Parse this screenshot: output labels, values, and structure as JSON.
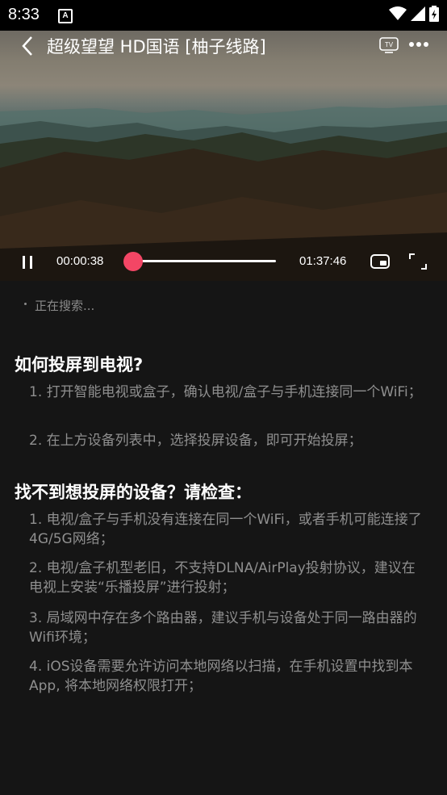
{
  "status_bar": {
    "time": "8:33",
    "notification_icon": "A"
  },
  "player": {
    "title": "超级望望 HD国语 [柚子线路]",
    "current_time": "00:00:38",
    "duration": "01:37:46",
    "progress": 0.0065,
    "tv_icon_label": "TV"
  },
  "cast": {
    "searching": "正在搜索...",
    "section1": {
      "heading": "如何投屏到电视?",
      "items": [
        "1. 打开智能电视或盒子，确认电视/盒子与手机连接同一个WiFi；",
        "2. 在上方设备列表中，选择投屏设备，即可开始投屏；"
      ]
    },
    "section2": {
      "heading": "找不到想投屏的设备？请检查：",
      "items": [
        "1. 电视/盒子与手机没有连接在同一个WiFi，或者手机可能连接了4G/5G网络；",
        "2. 电视/盒子机型老旧，不支持DLNA/AirPlay投射协议，建议在电视上安装“乐播投屏”进行投射；",
        "3. 局域网中存在多个路由器，建议手机与设备处于同一路由器的Wifi环境；",
        "4. iOS设备需要允许访问本地网络以扫描，在手机设置中找到本App, 将本地网络权限打开；"
      ]
    }
  },
  "colors": {
    "accent": "#f34665",
    "background": "#151515"
  }
}
